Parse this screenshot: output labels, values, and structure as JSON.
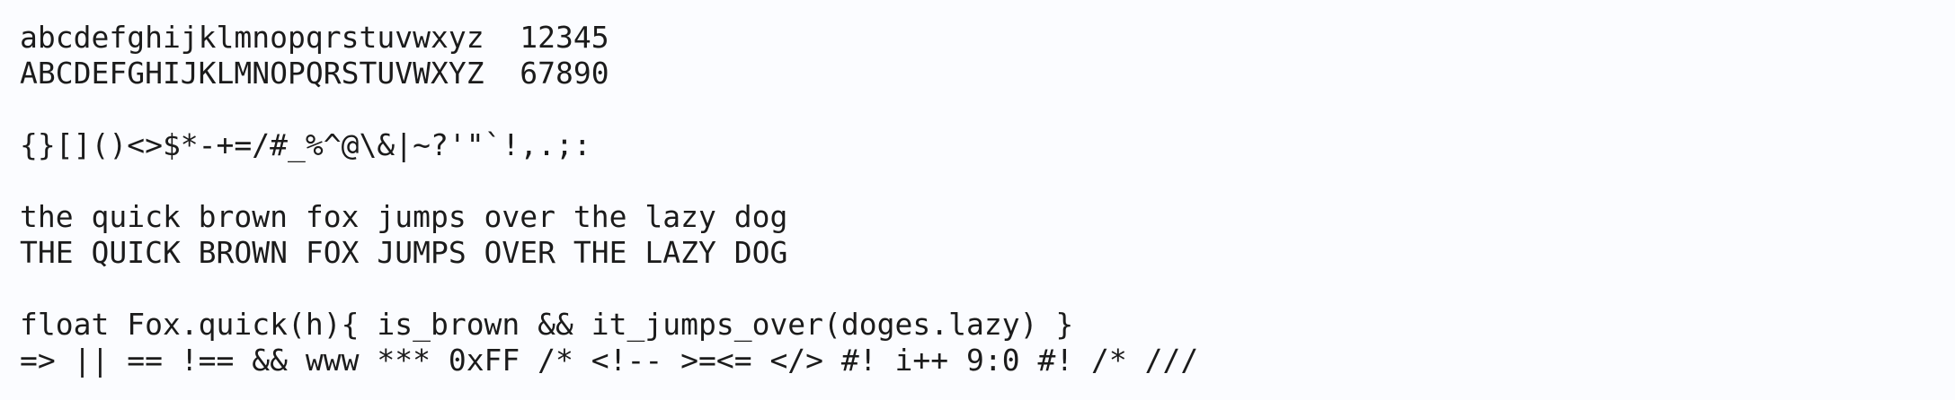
{
  "specimen": {
    "lowercase": "abcdefghijklmnopqrstuvwxyz  12345",
    "uppercase": "ABCDEFGHIJKLMNOPQRSTUVWXYZ  67890",
    "symbols": "{}[]()<>$*-+=/#_%^@\\&|~?'\"`!,.;:",
    "pangram_lower": "the quick brown fox jumps over the lazy dog",
    "pangram_upper": "THE QUICK BROWN FOX JUMPS OVER THE LAZY DOG",
    "code_line": "float Fox.quick(h){ is_brown && it_jumps_over(doges.lazy) }",
    "ligatures_line": "=> || == !== && www *** 0xFF /* <!-- >=<= </> #! i++ 9:0 #! /* ///"
  }
}
